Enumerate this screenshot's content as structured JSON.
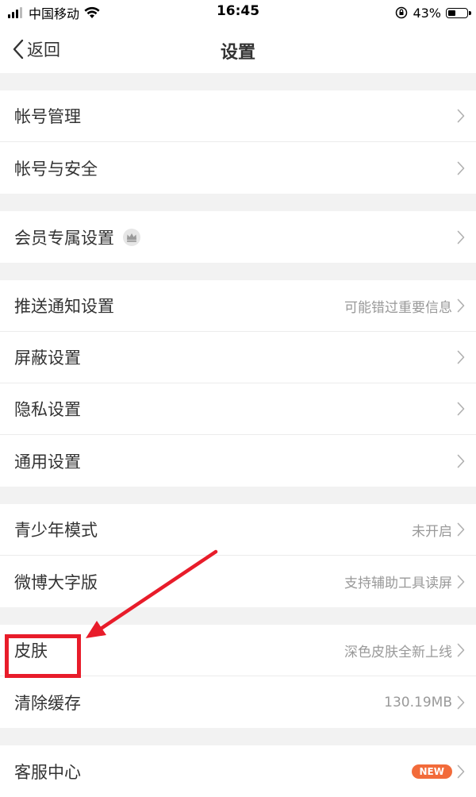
{
  "status_bar": {
    "carrier": "中国移动",
    "time": "16:45",
    "battery": "43%",
    "battery_level": 0.43
  },
  "nav": {
    "back_label": "返回",
    "title": "设置"
  },
  "groups": [
    [
      {
        "label": "帐号管理",
        "value": ""
      },
      {
        "label": "帐号与安全",
        "value": ""
      }
    ],
    [
      {
        "label": "会员专属设置",
        "value": "",
        "icon": "crown-icon"
      }
    ],
    [
      {
        "label": "推送通知设置",
        "value": "可能错过重要信息"
      },
      {
        "label": "屏蔽设置",
        "value": ""
      },
      {
        "label": "隐私设置",
        "value": ""
      },
      {
        "label": "通用设置",
        "value": ""
      }
    ],
    [
      {
        "label": "青少年模式",
        "value": "未开启"
      },
      {
        "label": "微博大字版",
        "value": "支持辅助工具读屏"
      }
    ],
    [
      {
        "label": "皮肤",
        "value": "深色皮肤全新上线"
      },
      {
        "label": "清除缓存",
        "value": "130.19MB"
      }
    ],
    [
      {
        "label": "客服中心",
        "value": "",
        "badge": "NEW"
      }
    ]
  ],
  "annotation": {
    "color": "#e81c2a",
    "target": "皮肤"
  }
}
